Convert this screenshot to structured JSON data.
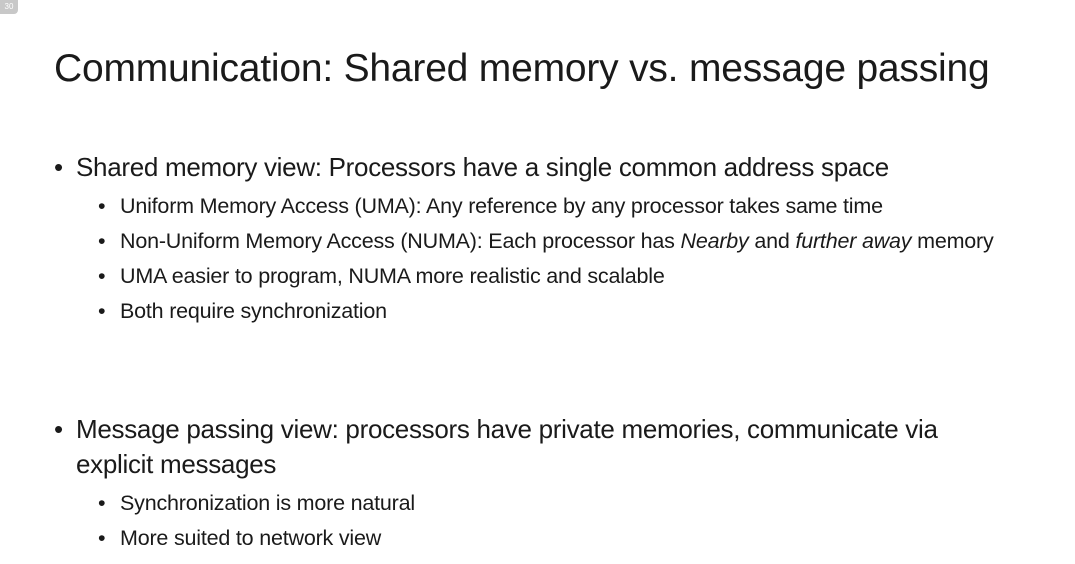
{
  "slide": {
    "badge": "30",
    "title": "Communication: Shared memory vs. message passing",
    "sections": [
      {
        "heading": "Shared memory view: Processors have a single common address space",
        "items": [
          {
            "text": "Uniform Memory Access (UMA): Any reference by any processor takes same time"
          },
          {
            "text_before": "Non-Uniform Memory Access (NUMA): Each processor has ",
            "emph_1": "Nearby",
            "text_middle": " and ",
            "emph_2": "further away",
            "text_after": " memory"
          },
          {
            "text": "UMA easier to program, NUMA more realistic and scalable"
          },
          {
            "text": "Both require synchronization"
          }
        ]
      },
      {
        "heading": "Message passing view: processors have private memories, communicate via explicit messages",
        "items": [
          {
            "text": "Synchronization is more natural"
          },
          {
            "text": "More suited to network view"
          }
        ]
      }
    ]
  }
}
